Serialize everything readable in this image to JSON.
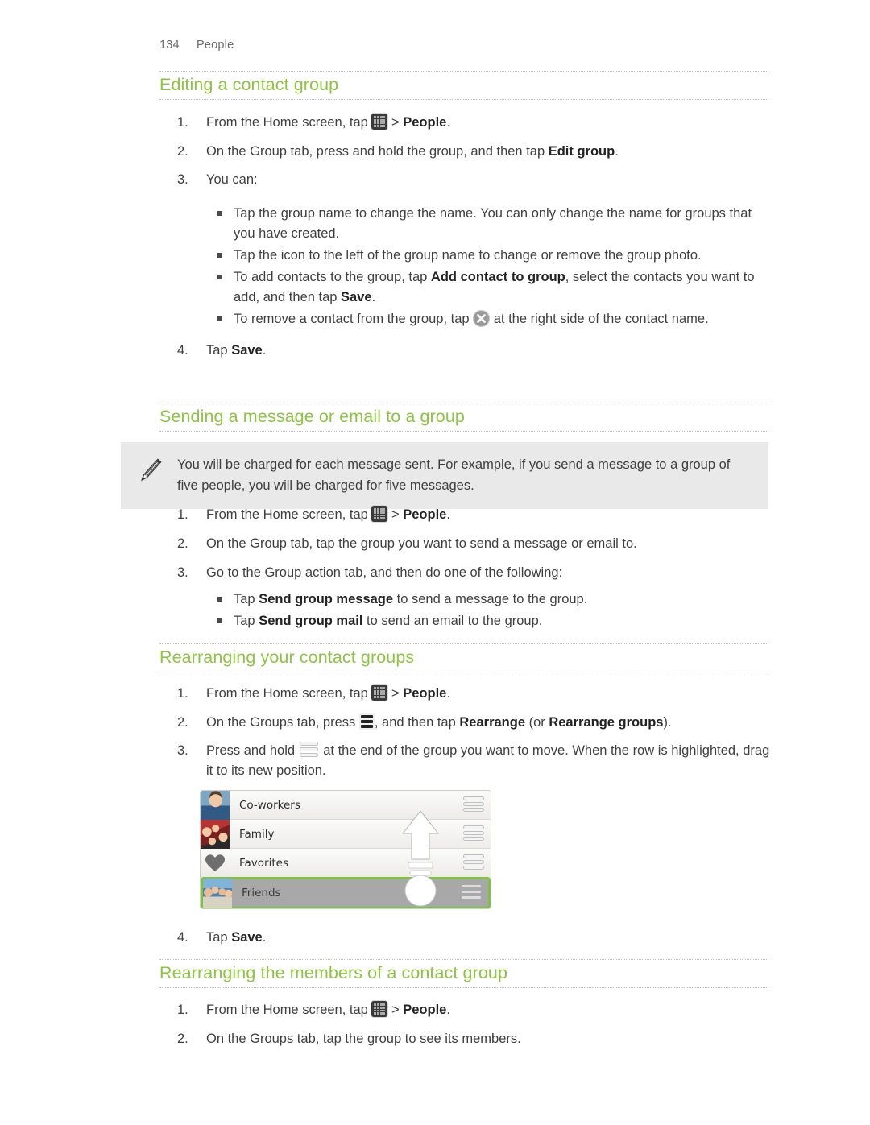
{
  "page": {
    "number": "134",
    "chapter": "People",
    "heading_color": "#8cc63e"
  },
  "sections": [
    {
      "id": "editing",
      "title": "Editing a contact group",
      "steps": [
        {
          "num": "1.",
          "before": "From the Home screen, tap ",
          "icon": "app-drawer-icon",
          "after": " > ",
          "bold": "People",
          "tail": "."
        },
        {
          "num": "2.",
          "before": "On the Group tab, press and hold the group, and then tap ",
          "bold": "Edit group",
          "tail": "."
        },
        {
          "num": "3.",
          "before": "You can:"
        },
        {
          "num": "4.",
          "before": "Tap ",
          "bold": "Save",
          "tail": "."
        }
      ],
      "bullets": [
        {
          "text": "Tap the group name to change the name. You can only change the name for groups that you have created."
        },
        {
          "text": "Tap the icon to the left of the group name to change or remove the group photo."
        },
        {
          "pre": "To add contacts to the group, tap ",
          "bold1": "Add contact to group",
          "mid": ", select the contacts you want to add, and then tap ",
          "bold2": "Save",
          "post": "."
        },
        {
          "pre": "To remove a contact from the group, tap ",
          "icon": "close-icon",
          "post": " at the right side of the contact name."
        }
      ]
    },
    {
      "id": "sending",
      "title": "Sending a message or email to a group",
      "note": {
        "icon": "pencil-icon",
        "text": "You will be charged for each message sent. For example, if you send a message to a group of five people, you will be charged for five messages."
      },
      "steps": [
        {
          "num": "1.",
          "before": "From the Home screen, tap ",
          "icon": "app-drawer-icon",
          "after": " > ",
          "bold": "People",
          "tail": "."
        },
        {
          "num": "2.",
          "before": "On the Group tab, tap the group you want to send a message or email to."
        },
        {
          "num": "3.",
          "before": "Go to the Group action tab, and then do one of the following:"
        }
      ],
      "bullets": [
        {
          "pre": "Tap ",
          "bold1": "Send group message",
          "post": " to send a message to the group."
        },
        {
          "pre": "Tap ",
          "bold1": "Send group mail",
          "post": " to send an email to the group."
        }
      ]
    },
    {
      "id": "rearranging-groups",
      "title": "Rearranging your contact groups",
      "steps": [
        {
          "num": "1.",
          "before": "From the Home screen, tap ",
          "icon": "app-drawer-icon",
          "after": " > ",
          "bold": "People",
          "tail": "."
        },
        {
          "num": "2.",
          "before": "On the Groups tab, press ",
          "icon": "menu-icon",
          "mid": ", and then tap ",
          "bold1": "Rearrange",
          "mid2": " (or ",
          "bold2": "Rearrange groups",
          "tail": ")."
        },
        {
          "num": "3.",
          "before": "Press and hold ",
          "icon": "drag-handle-icon",
          "mid": " at the end of the group you want to move. When the row is highlighted, drag it to its new position."
        },
        {
          "num": "4.",
          "before": "Tap ",
          "bold": "Save",
          "tail": "."
        }
      ],
      "figure": {
        "name": "rearrange-groups-screenshot",
        "rows": [
          {
            "label": "Co-workers",
            "thumb": "photo-coworkers",
            "selected": false
          },
          {
            "label": "Family",
            "thumb": "photo-family",
            "selected": false
          },
          {
            "label": "Favorites",
            "thumb": "heart-icon",
            "selected": false
          },
          {
            "label": "Friends",
            "thumb": "photo-friends",
            "selected": true
          }
        ],
        "gesture": "drag-up-arrow-with-finger"
      }
    },
    {
      "id": "rearranging-members",
      "title": "Rearranging the members of a contact group",
      "steps": [
        {
          "num": "1.",
          "before": "From the Home screen, tap ",
          "icon": "app-drawer-icon",
          "after": " > ",
          "bold": "People",
          "tail": "."
        },
        {
          "num": "2.",
          "before": "On the Groups tab, tap the group to see its members."
        }
      ]
    }
  ]
}
